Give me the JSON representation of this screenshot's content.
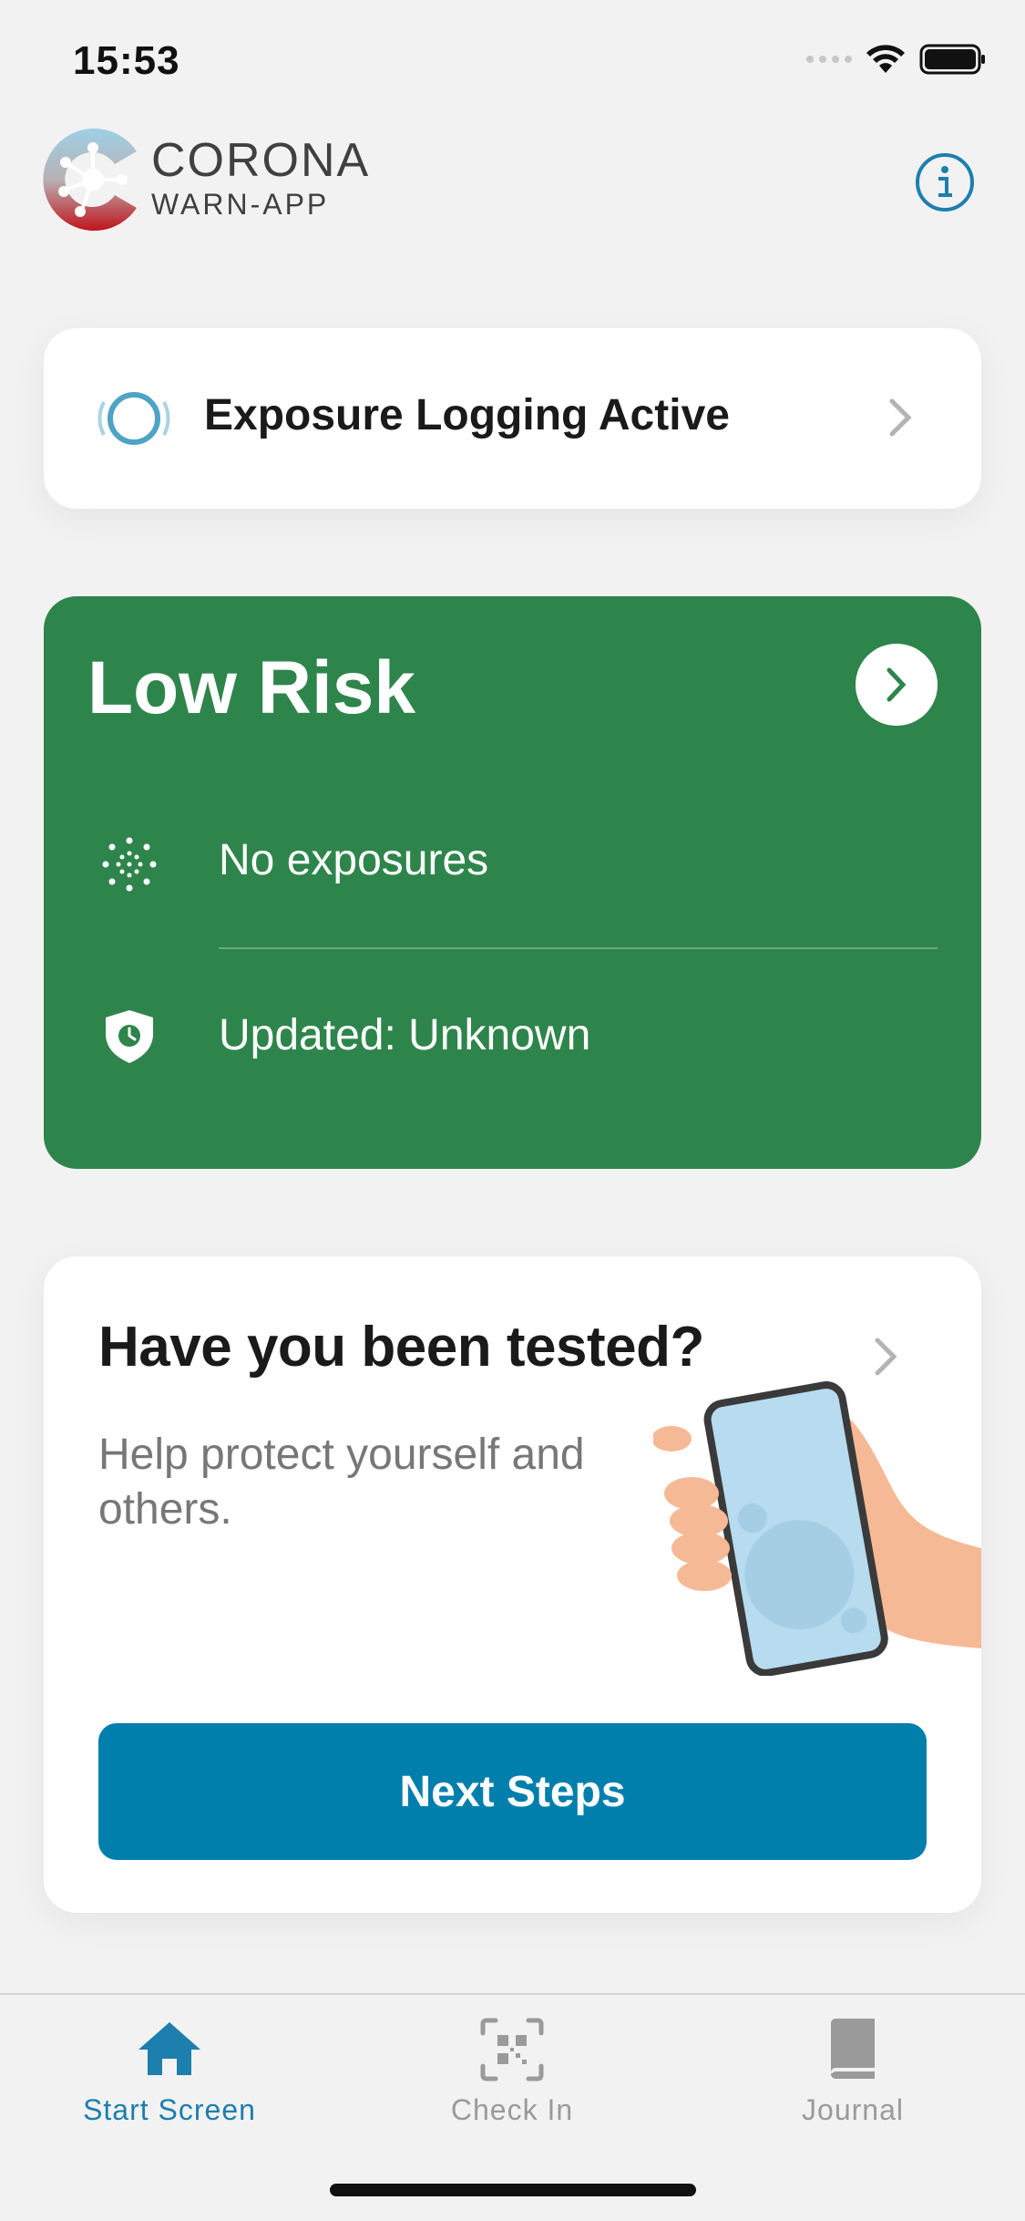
{
  "status_bar": {
    "time": "15:53"
  },
  "header": {
    "brand_top": "CORONA",
    "brand_sub": "WARN-APP"
  },
  "exposure_card": {
    "label": "Exposure Logging Active"
  },
  "risk_card": {
    "title": "Low Risk",
    "exposures": "No exposures",
    "updated": "Updated: Unknown",
    "color": "#2e854b"
  },
  "tested_card": {
    "title": "Have you been tested?",
    "description": "Help protect yourself and others.",
    "button_label": "Next Steps",
    "button_color": "#007fad"
  },
  "tabbar": {
    "tabs": [
      {
        "label": "Start Screen",
        "active": true
      },
      {
        "label": "Check In",
        "active": false
      },
      {
        "label": "Journal",
        "active": false
      }
    ],
    "active_color": "#1d7fad",
    "inactive_color": "#9a9a9a"
  }
}
